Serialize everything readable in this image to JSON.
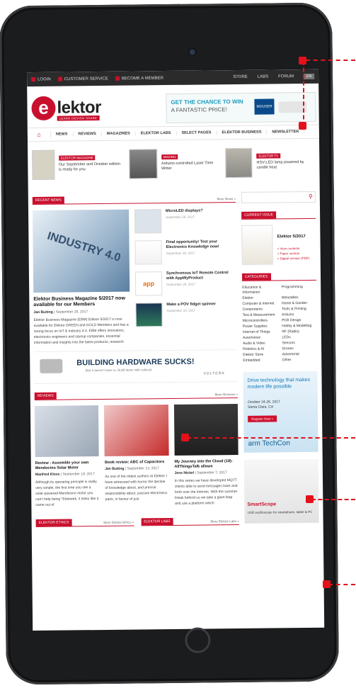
{
  "topbar": {
    "login": "LOGIN",
    "service": "CUSTOMER SERVICE",
    "member": "BECOME A MEMBER",
    "store": "STORE",
    "labs": "LABS",
    "forum": "FORUM",
    "lang": "EN"
  },
  "brand": {
    "name": "lektor",
    "letter": "e",
    "tagline": "LEARN DESIGN SHARE"
  },
  "top_ad": {
    "line1": "GET THE CHANCE TO WIN",
    "line2": "A FANTASTIC PRICE!",
    "sponsor": "MOUSER"
  },
  "nav": [
    "NEWS",
    "REVIEWS",
    "MAGAZINES",
    "ELEKTOR LABS",
    "SELECT PAGES",
    "ELEKTOR BUSINESS",
    "NEWSLETTER"
  ],
  "strip": [
    {
      "tag": "ELEKTOR MAGAZINE",
      "text": "Our September and October edition is ready for you"
    },
    {
      "tag": "MAKING",
      "text": "Arduino-controlled Laser Time Writer"
    },
    {
      "tag": "ELEKTOR TV",
      "text": "HSV-LED lamp powered by candle heat"
    }
  ],
  "recent": {
    "label": "RECENT NEWS",
    "more": "More News »",
    "feature": {
      "img_text": "INDUSTRY 4.0",
      "title": "Elektor Business Magazine 5/2017 now available for our Members",
      "author": "Jan Buiting",
      "date": "September 28, 2017",
      "body": "Elektor Business Magazine (EBM) Edition 5/2017 is now available for Elektor GREEN and GOLD Members and has a strong focus on IoT & Industry 4.0. EBM offers innovators, electronics engineers and startup companies, essential information and insights into the latest products, research"
    },
    "items": [
      {
        "title": "MicroLED displays?",
        "date": "September 26, 2017"
      },
      {
        "title": "Final opportunity! Test your Electronics Knowledge now!",
        "date": "September 26, 2017"
      },
      {
        "title": "Synchronous IoT Remote Control with AppWyProduct",
        "date": "September 26, 2017",
        "thumb": "app"
      },
      {
        "title": "Make a POV fidget spinner",
        "date": "September 19, 2017"
      }
    ]
  },
  "banner": {
    "headline": "BUILDING HARDWARE SUCKS!",
    "sub": "(But it doesn't have to. Build faster with voltera)",
    "brand": "VOLTERA"
  },
  "reviews": {
    "label": "REVIEWS",
    "more": "More Reviews »",
    "items": [
      {
        "title": "Review : Assemble your own Mendocino Solar Motor",
        "author": "Manfred Kloss",
        "date": "September 18, 2017",
        "body": "Although its operating principle is really very simple, the first time you see a solar-powered Mendocino motor you can't help being \"Eeeeeek, it looks like it came out of"
      },
      {
        "title": "Book review: ABC of Capacitors",
        "author": "Jan Buiting",
        "date": "September 13, 2017",
        "body": "As one of the oldest authors at Elektor I have witnessed with horror the decline of knowledge about, and precise responsibility about, passive electronics parts, in favour of just"
      },
      {
        "title": "My Journey into the Cloud (18): AllThingsTalk allows",
        "author": "Jens Nickel",
        "date": "September 7, 2017",
        "body": "In this series we have developed MQTT clients able to send messages back and forth over the Internet. With the summer break behind us we take a giant leap and use a platform which"
      }
    ]
  },
  "footer": {
    "ethics": "ELEKTOR ETHICS",
    "more_ethics": "More Elektor Ethics »",
    "labs": "ELEKTOR LABS",
    "more_labs": "More Elektor Labs »"
  },
  "side": {
    "issue_label": "CURRENT ISSUE",
    "issue_title": "Elektor 5/2017",
    "issue_links": "» View contents\n» Paper version\n» Digital version (PDF)",
    "cat_label": "CATEGORIES",
    "cats_left": [
      "Education & Information",
      "Elektor",
      "Computer & Internet",
      "Components",
      "Test & Measurement",
      "Microcontrollers",
      "Power Supplies",
      "Internet of Things",
      "Automotive",
      "Audio & Video",
      "Robotics & AI",
      "Elektor Store",
      "Embedded"
    ],
    "cats_right": [
      "Programming",
      "Wearables",
      "Home & Garden",
      "Tools & Printing",
      "Arduino",
      "PCB Design",
      "Hobby & Modelling",
      "RF (Radio)",
      "LEDs",
      "Sensors",
      "Drones",
      "Advertorial",
      "Other"
    ],
    "ad1": {
      "headline": "Drive technology that makes modern life possible",
      "dates": "October 24-26, 2017\nSanta Clara, CA",
      "button": "Register Now »",
      "brand": "arm TechCon"
    },
    "ad2": {
      "title": "SmartScope",
      "sub": "USB oscilloscope for smartphone, tablet & PC"
    }
  },
  "accent": "#c8102e"
}
